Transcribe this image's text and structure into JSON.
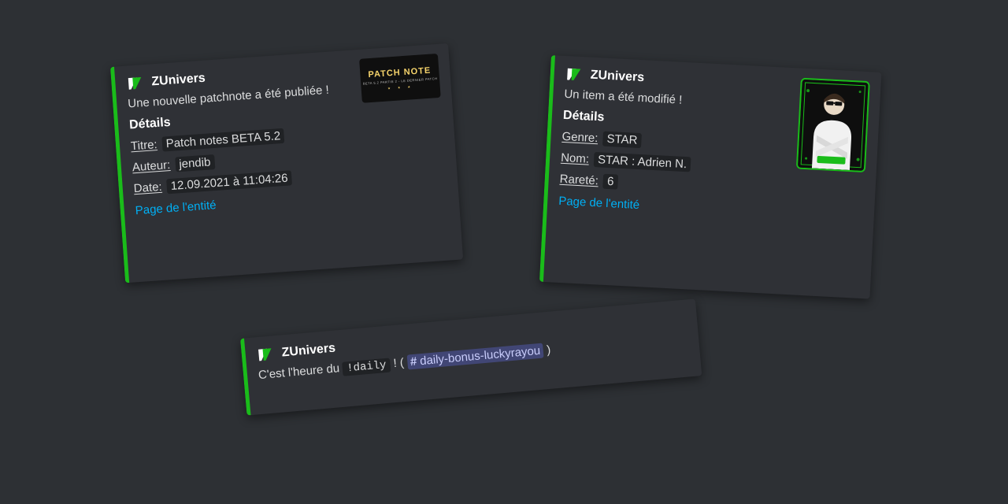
{
  "brand": "ZUnivers",
  "details_heading": "Détails",
  "entity_link_label": "Page de l'entité",
  "card_patch": {
    "lead": "Une nouvelle patchnote a été publiée !",
    "fields": [
      {
        "key": "Titre:",
        "value": "Patch notes BETA 5.2"
      },
      {
        "key": "Auteur:",
        "value": "jendib"
      },
      {
        "key": "Date:",
        "value": "12.09.2021 à 11:04:26"
      }
    ],
    "thumb": {
      "title": "PATCH NOTE",
      "subtitle": "BETA 5.2 PARTIE 2 - LE DERNIER PATCH"
    }
  },
  "card_item": {
    "lead": "Un item a été modifié !",
    "fields": [
      {
        "key": "Genre:",
        "value": "STAR"
      },
      {
        "key": "Nom:",
        "value": "STAR : Adrien N."
      },
      {
        "key": "Rareté:",
        "value": "6"
      }
    ]
  },
  "card_daily": {
    "prefix": "C'est l'heure du ",
    "command": "!daily",
    "mid": " ! ( ",
    "channel": "daily-bonus-luckyrayou",
    "suffix": " )"
  }
}
